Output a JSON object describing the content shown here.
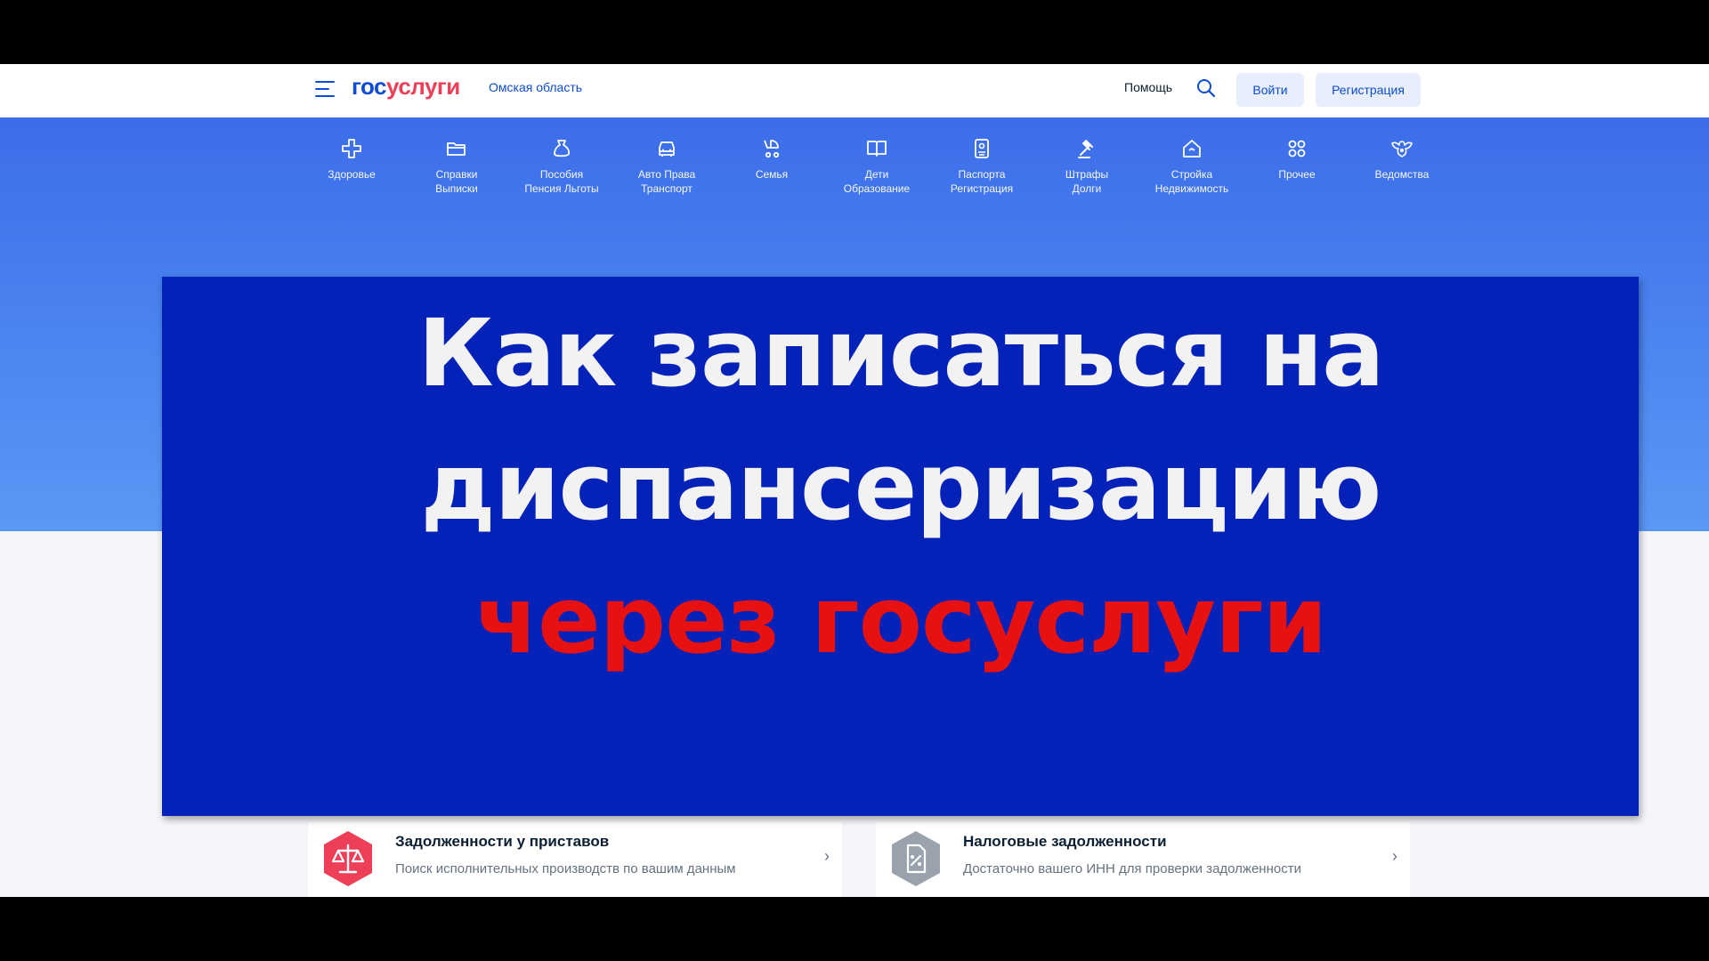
{
  "header": {
    "logo_part1": "гос",
    "logo_part2": "услуги",
    "region": "Омская область",
    "help": "Помощь",
    "login": "Войти",
    "register": "Регистрация"
  },
  "categories": [
    {
      "line1": "Здоровье",
      "line2": "",
      "icon": "health-cross-icon"
    },
    {
      "line1": "Справки",
      "line2": "Выписки",
      "icon": "folder-icon"
    },
    {
      "line1": "Пособия",
      "line2": "Пенсия Льготы",
      "icon": "money-bag-icon"
    },
    {
      "line1": "Авто Права",
      "line2": "Транспорт",
      "icon": "car-icon"
    },
    {
      "line1": "Семья",
      "line2": "",
      "icon": "stroller-icon"
    },
    {
      "line1": "Дети",
      "line2": "Образование",
      "icon": "book-icon"
    },
    {
      "line1": "Паспорта",
      "line2": "Регистрация",
      "icon": "passport-icon"
    },
    {
      "line1": "Штрафы",
      "line2": "Долги",
      "icon": "gavel-icon"
    },
    {
      "line1": "Стройка",
      "line2": "Недвижимость",
      "icon": "house-icon"
    },
    {
      "line1": "Прочее",
      "line2": "",
      "icon": "grid-icon"
    },
    {
      "line1": "Ведомства",
      "line2": "",
      "icon": "eagle-emblem-icon"
    }
  ],
  "overlay": {
    "line1": "Как записаться на",
    "line2": "диспансеризацию",
    "line3": "через госуслуги"
  },
  "cards": [
    {
      "title": "Задолженности у приставов",
      "subtitle": "Поиск исполнительных производств по вашим данным",
      "icon": "scales-icon",
      "color": "#ee3f58"
    },
    {
      "title": "Налоговые задолженности",
      "subtitle": "Достаточно вашего ИНН для проверки задолженности",
      "icon": "tax-document-icon",
      "color": "#9aa3ad"
    }
  ],
  "colors": {
    "brand_blue": "#0d4cd3",
    "brand_red": "#ee3f58",
    "overlay_bg": "#0422b8",
    "overlay_accent": "#e81111"
  }
}
